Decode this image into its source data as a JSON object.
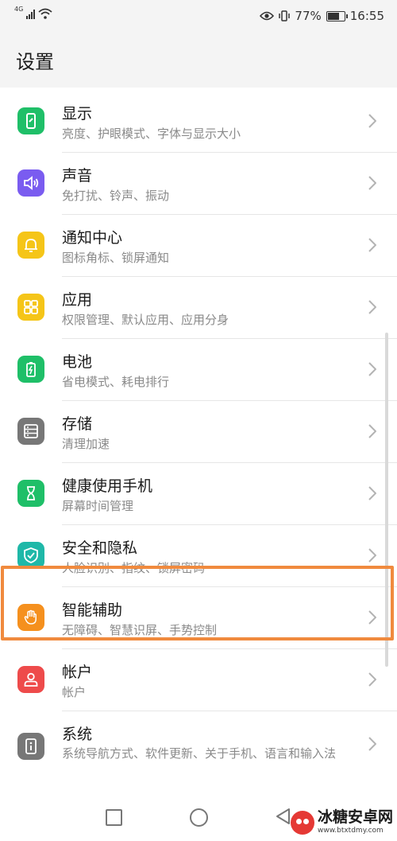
{
  "status_bar": {
    "network": "4G",
    "battery_text": "77%",
    "battery_level": 0.77,
    "time": "16:55"
  },
  "header": {
    "title": "设置"
  },
  "items": [
    {
      "title": "显示",
      "subtitle": "亮度、护眼模式、字体与显示大小",
      "icon": "display-icon",
      "color": "#1fbf68"
    },
    {
      "title": "声音",
      "subtitle": "免打扰、铃声、振动",
      "icon": "speaker-icon",
      "color": "#7a5cf0"
    },
    {
      "title": "通知中心",
      "subtitle": "图标角标、锁屏通知",
      "icon": "bell-icon",
      "color": "#f5c518"
    },
    {
      "title": "应用",
      "subtitle": "权限管理、默认应用、应用分身",
      "icon": "apps-grid-icon",
      "color": "#f5c518"
    },
    {
      "title": "电池",
      "subtitle": "省电模式、耗电排行",
      "icon": "battery-icon",
      "color": "#1fbf68"
    },
    {
      "title": "存储",
      "subtitle": "清理加速",
      "icon": "storage-icon",
      "color": "#777777"
    },
    {
      "title": "健康使用手机",
      "subtitle": "屏幕时间管理",
      "icon": "hourglass-icon",
      "color": "#1fbf68"
    },
    {
      "title": "安全和隐私",
      "subtitle": "人脸识别、指纹、锁屏密码",
      "icon": "shield-icon",
      "color": "#1fb8a8"
    },
    {
      "title": "智能辅助",
      "subtitle": "无障碍、智慧识屏、手势控制",
      "icon": "hand-icon",
      "color": "#f5901e"
    },
    {
      "title": "帐户",
      "subtitle": "帐户",
      "icon": "user-icon",
      "color": "#ee4b4b"
    },
    {
      "title": "系统",
      "subtitle": "系统导航方式、软件更新、关于手机、语言和输入法",
      "icon": "system-info-icon",
      "color": "#777777"
    }
  ],
  "watermark": {
    "title": "冰糖安卓网",
    "url": "www.btxtdmy.com"
  }
}
